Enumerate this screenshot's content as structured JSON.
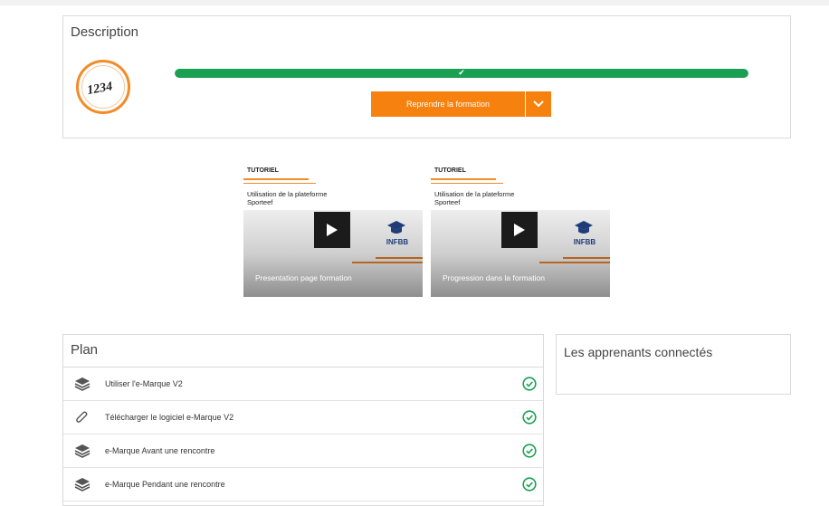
{
  "description": {
    "title": "Description",
    "logo_text": "1234",
    "progress_fraction": 1.0,
    "progress_check": "✔",
    "resume_label": "Reprendre la formation",
    "accent_color": "#f7810f",
    "progress_color": "#1aa053"
  },
  "videos": [
    {
      "tag": "TUTORIEL",
      "subtitle": "Utilisation de la plateforme Sporteef",
      "brand": "INFBB",
      "title": "Presentation page formation"
    },
    {
      "tag": "TUTORIEL",
      "subtitle": "Utilisation de la plateforme Sporteef",
      "brand": "INFBB",
      "title": "Progression dans la formation"
    }
  ],
  "plan": {
    "title": "Plan",
    "items": [
      {
        "label": "Utiliser l'e-Marque V2",
        "icon": "layers-icon",
        "completed": true
      },
      {
        "label": "Télécharger le logiciel e-Marque V2",
        "icon": "paperclip-icon",
        "completed": true
      },
      {
        "label": "e-Marque Avant une rencontre",
        "icon": "layers-icon",
        "completed": true
      },
      {
        "label": "e-Marque Pendant une rencontre",
        "icon": "layers-icon",
        "completed": true
      }
    ]
  },
  "learners": {
    "title": "Les apprenants connectés"
  }
}
